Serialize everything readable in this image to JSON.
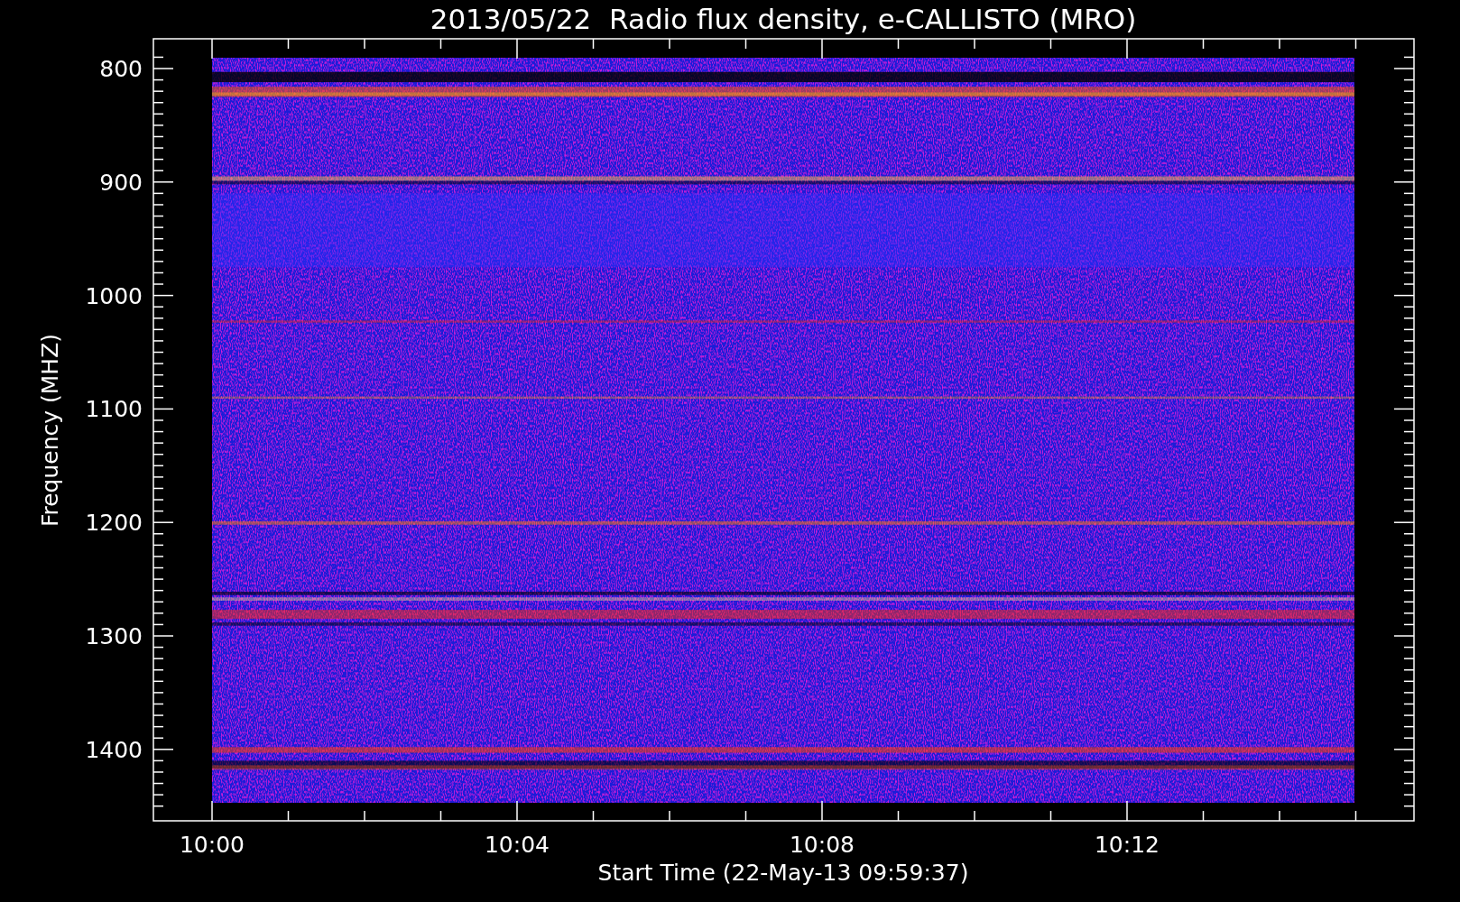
{
  "title": "2013/05/22  Radio flux density, e-CALLISTO (MRO)",
  "y_axis": {
    "label": "Frequency (MHZ)",
    "ticks": [
      "800",
      "900",
      "1000",
      "1100",
      "1200",
      "1300",
      "1400"
    ]
  },
  "x_axis": {
    "label": "Start Time (22-May-13 09:59:37)",
    "ticks": [
      "10:00",
      "10:04",
      "10:08",
      "10:12"
    ]
  }
}
